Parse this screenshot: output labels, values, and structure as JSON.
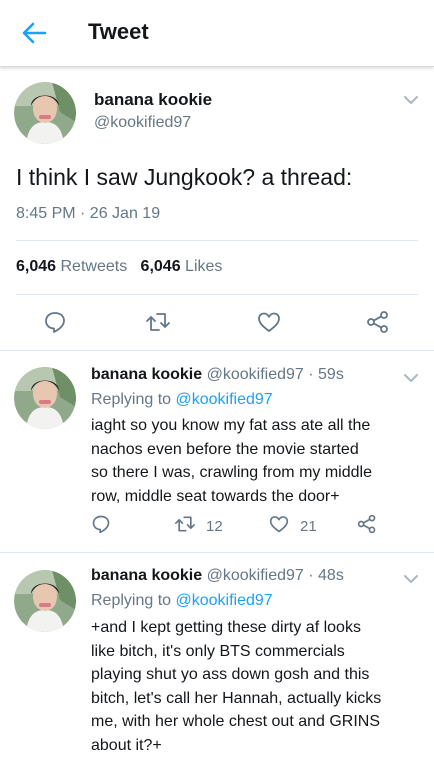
{
  "header": {
    "title": "Tweet"
  },
  "main_tweet": {
    "name": "banana kookie",
    "handle": "@kookified97",
    "text": "I think I saw Jungkook? a thread:",
    "timestamp": "8:45 PM · 26 Jan 19",
    "retweets_count": "6,046",
    "retweets_label": "Retweets",
    "likes_count": "6,046",
    "likes_label": "Likes"
  },
  "replies": [
    {
      "name": "banana kookie",
      "handle_time": "@kookified97 · 59s",
      "replying_label": "Replying to",
      "replying_to": "@kookified97",
      "lines": [
        "iaght so you know my fat ass ate all the",
        "nachos even before the movie started",
        "so there I was, crawling from my middle",
        "row, middle seat towards the door+"
      ],
      "retweets": "12",
      "likes": "21"
    },
    {
      "name": "banana kookie",
      "handle_time": "@kookified97 · 48s",
      "replying_label": "Replying to",
      "replying_to": "@kookified97",
      "lines": [
        "+and I kept getting these dirty af looks",
        "like bitch, it's only BTS commercials",
        "playing shut yo ass down gosh and this",
        "bitch, let's call her Hannah, actually kicks",
        "me, with her whole chest out and GRINS",
        "about it?+"
      ]
    }
  ],
  "icons": {
    "back": "arrow-left-icon",
    "chevron": "chevron-down-icon",
    "reply": "reply-icon",
    "retweet": "retweet-icon",
    "like": "heart-icon",
    "share": "share-icon"
  },
  "colors": {
    "accent": "#1da1f2",
    "secondary_text": "#657786",
    "primary_text": "#14171a",
    "border": "#e1e8ed"
  }
}
